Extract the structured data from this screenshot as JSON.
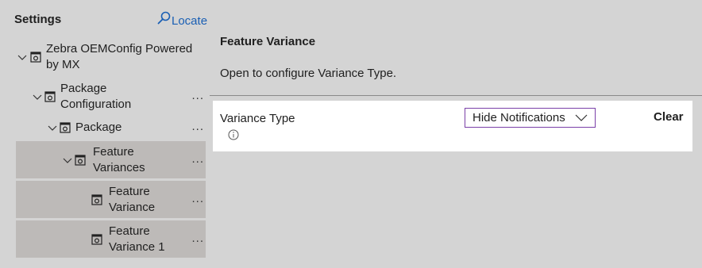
{
  "sidebar": {
    "title": "Settings",
    "locate_label": "Locate",
    "more_label": "...",
    "items": [
      {
        "label_lines": [
          "Zebra OEMConfig Powered",
          "by MX"
        ],
        "expanded": true,
        "has_more": false,
        "selected": false
      },
      {
        "label_lines": [
          "Package",
          "Configuration"
        ],
        "expanded": true,
        "has_more": true,
        "selected": false
      },
      {
        "label_lines": [
          "Package"
        ],
        "expanded": true,
        "has_more": true,
        "selected": false
      },
      {
        "label_lines": [
          "Feature",
          "Variances"
        ],
        "expanded": true,
        "has_more": true,
        "selected": true
      },
      {
        "label_lines": [
          "Feature",
          "Variance"
        ],
        "expanded": false,
        "has_more": true,
        "selected": true
      },
      {
        "label_lines": [
          "Feature",
          "Variance 1"
        ],
        "expanded": false,
        "has_more": true,
        "selected": true
      }
    ]
  },
  "main": {
    "title": "Feature Variance",
    "description": "Open to configure Variance Type.",
    "setting": {
      "label": "Variance Type",
      "info_icon": "info-icon",
      "value": "Hide Notifications",
      "clear_label": "Clear"
    }
  },
  "colors": {
    "background": "#d4d4d4",
    "selected_row": "#bdbab8",
    "accent_link": "#1a5fb4",
    "dropdown_border": "#7a3fa8"
  }
}
